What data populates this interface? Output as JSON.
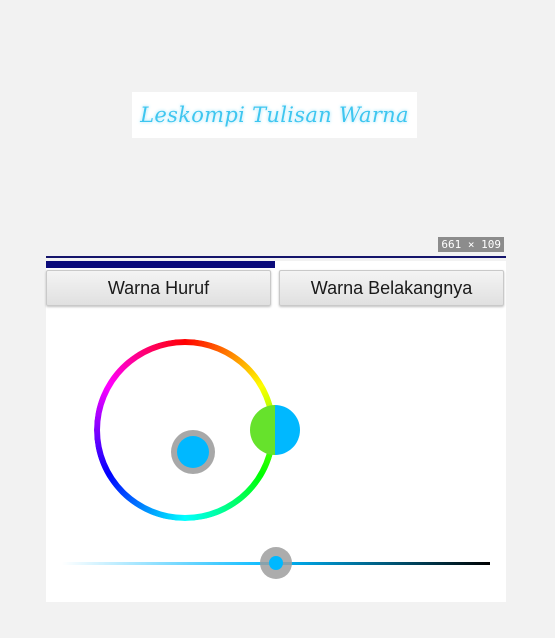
{
  "preview": {
    "text": "Leskompi Tulisan Warna",
    "text_color": "#3ec6f0",
    "background_color": "#ffffff"
  },
  "size_badge": "661 × 109",
  "tabs": [
    {
      "label": "Warna Huruf",
      "selected": true
    },
    {
      "label": "Warna Belakangnya",
      "selected": false
    }
  ],
  "color_picker": {
    "old_color": "#66e22c",
    "new_color": "#00b8ff",
    "selector_thumb_color": "#00b8ff",
    "brightness_thumb_color": "#00b8ff",
    "brightness_value": 0.5
  },
  "colors": {
    "accent": "#0b0b7a",
    "divider": "#14146b"
  }
}
